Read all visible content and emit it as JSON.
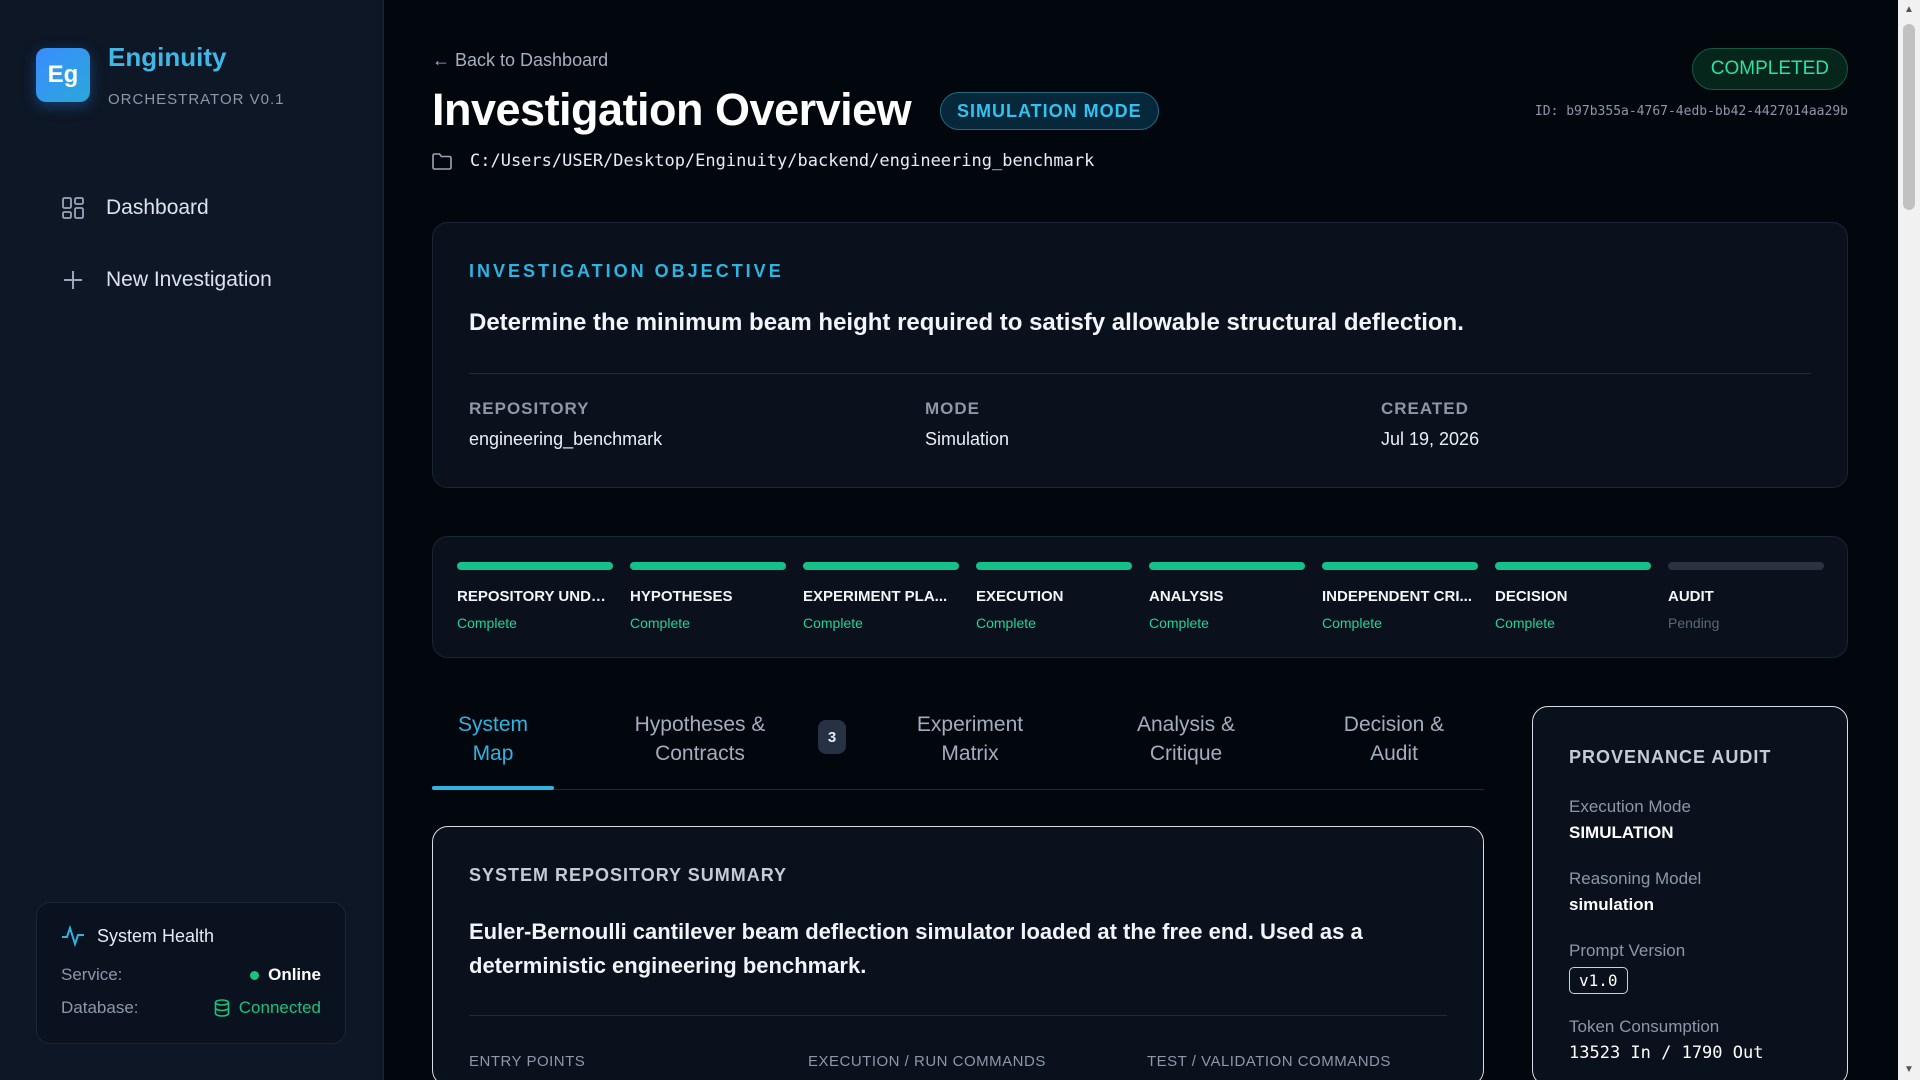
{
  "brand": {
    "logo": "Eg",
    "name": "Enginuity",
    "subtitle": "ORCHESTRATOR V0.1"
  },
  "nav": [
    {
      "label": "Dashboard",
      "icon": "grid-icon"
    },
    {
      "label": "New Investigation",
      "icon": "plus-icon"
    }
  ],
  "health": {
    "title": "System Health",
    "service_label": "Service:",
    "service_value": "Online",
    "db_label": "Database:",
    "db_value": "Connected",
    "status_color": "#19c37d"
  },
  "header": {
    "back": "← Back to Dashboard",
    "title": "Investigation Overview",
    "mode_badge": "SIMULATION MODE",
    "path": "C:/Users/USER/Desktop/Enginuity/backend/engineering_benchmark",
    "status": "COMPLETED",
    "id": "ID: b97b355a-4767-4edb-bb42-4427014aa29b"
  },
  "objective": {
    "label": "INVESTIGATION OBJECTIVE",
    "text": "Determine the minimum beam height required to satisfy allowable structural deflection.",
    "meta": [
      {
        "key": "REPOSITORY",
        "value": "engineering_benchmark"
      },
      {
        "key": "MODE",
        "value": "Simulation"
      },
      {
        "key": "CREATED",
        "value": "Jul 19, 2026"
      }
    ]
  },
  "progress": [
    {
      "name": "REPOSITORY UNDE...",
      "status": "Complete"
    },
    {
      "name": "HYPOTHESES",
      "status": "Complete"
    },
    {
      "name": "EXPERIMENT PLA...",
      "status": "Complete"
    },
    {
      "name": "EXECUTION",
      "status": "Complete"
    },
    {
      "name": "ANALYSIS",
      "status": "Complete"
    },
    {
      "name": "INDEPENDENT CRI...",
      "status": "Complete"
    },
    {
      "name": "DECISION",
      "status": "Complete"
    },
    {
      "name": "AUDIT",
      "status": "Pending"
    }
  ],
  "tabs": [
    {
      "line1": "System",
      "line2": "Map"
    },
    {
      "line1": "Hypotheses &",
      "line2": "Contracts",
      "badge": "3"
    },
    {
      "line1": "Experiment",
      "line2": "Matrix"
    },
    {
      "line1": "Analysis &",
      "line2": "Critique"
    },
    {
      "line1": "Decision &",
      "line2": "Audit"
    }
  ],
  "system_summary": {
    "title": "SYSTEM REPOSITORY SUMMARY",
    "text": "Euler-Bernoulli cantilever beam deflection simulator loaded at the free end. Used as a deterministic engineering benchmark.",
    "columns": [
      "ENTRY POINTS",
      "EXECUTION / RUN COMMANDS",
      "TEST / VALIDATION COMMANDS"
    ]
  },
  "provenance": {
    "title": "PROVENANCE AUDIT",
    "execution_mode_label": "Execution Mode",
    "execution_mode": "SIMULATION",
    "model_label": "Reasoning Model",
    "model": "simulation",
    "prompt_label": "Prompt Version",
    "prompt": "v1.0",
    "tokens_label": "Token Consumption",
    "tokens": "13523 In / 1790 Out"
  },
  "colors": {
    "accent": "#2fb4e0",
    "success": "#15c08a",
    "pending": "#2b3341"
  }
}
